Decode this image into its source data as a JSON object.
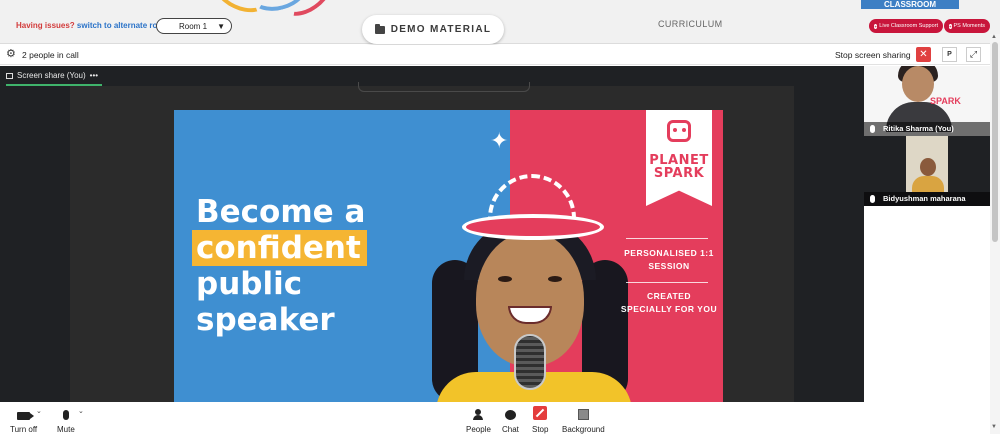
{
  "topbar": {
    "issue_text": "Having issues?",
    "alt_link": "switch to alternate room",
    "room_value": "Room 1",
    "demo_label": "DEMO MATERIAL",
    "curriculum_label": "CURRICULUM",
    "classroom_label": "CLASSROOM",
    "live_support_label": "Live Classroom Support",
    "ps_moments_label": "PS Moments"
  },
  "callbar": {
    "people_count": "2 people in call",
    "stop_sharing": "Stop screen sharing",
    "p_label": "P"
  },
  "stage": {
    "share_label": "Screen share (You)",
    "more_dots": "•••"
  },
  "slide": {
    "line1": "Become a",
    "line2": "confident",
    "line3": "public",
    "line4": "speaker",
    "sub1": "PERSONALISED 1:1 SESSION",
    "sub2": "CREATED SPECIALLY FOR YOU",
    "brand_line1": "PLANET",
    "brand_line2": "SPARK"
  },
  "participants": [
    {
      "name": "Ritika Sharma (You)",
      "brand": "SPARK"
    },
    {
      "name": "Bidyushman maharana"
    }
  ],
  "toolbar": {
    "camera_label": "Turn off",
    "mute_label": "Mute",
    "people_label": "People",
    "chat_label": "Chat",
    "stop_label": "Stop",
    "background_label": "Background"
  },
  "colors": {
    "accent_red": "#c8153b",
    "slide_blue": "#3f8fd1",
    "slide_red": "#e43d5c",
    "highlight_yellow": "#f5b533",
    "share_green": "#3fb36b"
  }
}
